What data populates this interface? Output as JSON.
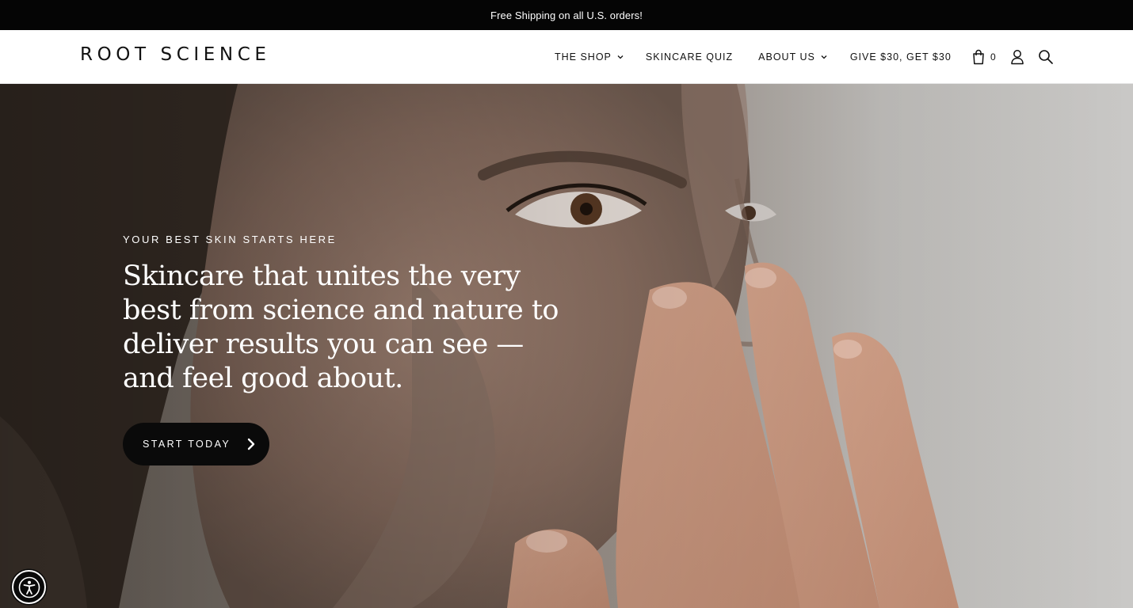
{
  "announcement": {
    "text": "Free Shipping on all U.S. orders!"
  },
  "header": {
    "logo": "ROOT SCIENCE",
    "nav": [
      {
        "label": "THE SHOP",
        "has_dropdown": true
      },
      {
        "label": "SKINCARE QUIZ",
        "has_dropdown": false
      },
      {
        "label": "ABOUT US",
        "has_dropdown": true
      },
      {
        "label": "GIVE $30, GET $30",
        "has_dropdown": false
      }
    ],
    "icons": {
      "cart": "shopping-bag-icon",
      "account": "user-icon",
      "search": "search-icon"
    },
    "cart_count": "0"
  },
  "hero": {
    "eyebrow": "YOUR BEST SKIN STARTS HERE",
    "headline": "Skincare that unites the very best from science and nature to deliver results you can see — and feel good about.",
    "cta_label": "START TODAY",
    "image_subject": "woman applying clay mask to face"
  },
  "accessibility": {
    "icon": "accessibility-icon"
  },
  "colors": {
    "announcement_bg": "#050505",
    "cta_bg": "#0a0a0a",
    "text_on_dark": "#ffffff",
    "nav_text": "#111111"
  }
}
